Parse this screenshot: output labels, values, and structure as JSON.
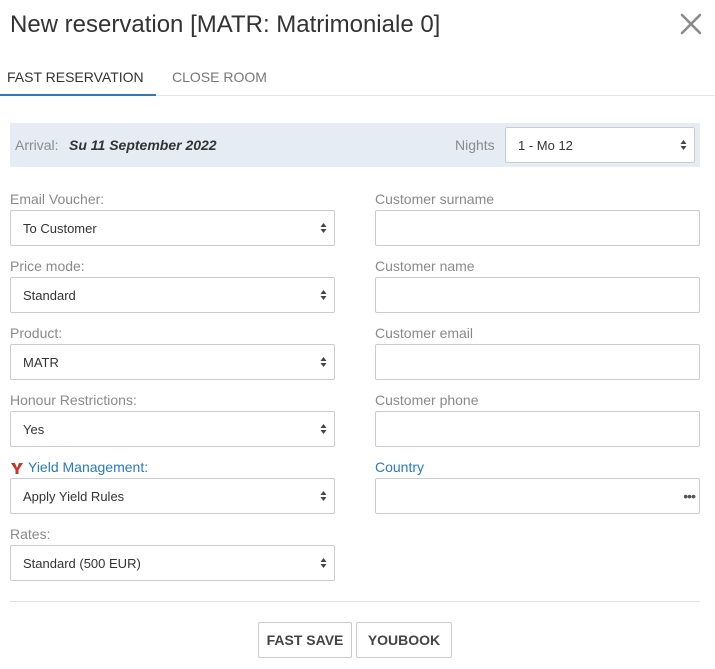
{
  "header": {
    "title": "New reservation [MATR: Matrimoniale 0]"
  },
  "tabs": [
    {
      "label": "FAST RESERVATION",
      "active": true
    },
    {
      "label": "CLOSE ROOM",
      "active": false
    }
  ],
  "arrival": {
    "label": "Arrival:",
    "date": "Su 11 September 2022",
    "nights_label": "Nights",
    "nights_value": "1 - Mo 12"
  },
  "left_fields": {
    "email_voucher": {
      "label": "Email Voucher:",
      "value": "To Customer"
    },
    "price_mode": {
      "label": "Price mode:",
      "value": "Standard"
    },
    "product": {
      "label": "Product:",
      "value": "MATR"
    },
    "honour_restrictions": {
      "label": "Honour Restrictions:",
      "value": "Yes"
    },
    "yield_management": {
      "label": "Yield Management:",
      "value": "Apply Yield Rules"
    },
    "rates": {
      "label": "Rates:",
      "value": "Standard (500 EUR)"
    }
  },
  "right_fields": {
    "surname": {
      "label": "Customer surname",
      "value": ""
    },
    "name": {
      "label": "Customer name",
      "value": ""
    },
    "email": {
      "label": "Customer email",
      "value": ""
    },
    "phone": {
      "label": "Customer phone",
      "value": ""
    },
    "country": {
      "label": "Country",
      "value": "",
      "more": "•••"
    }
  },
  "footer": {
    "fast_save": "FAST SAVE",
    "youbook": "YOUBOOK"
  },
  "colors": {
    "accent": "#2a7bbd",
    "arrival_bg": "#e6ecf4",
    "yield_icon": "#c0392b"
  },
  "icons": {
    "close": "close-icon",
    "select": "select-arrows-icon",
    "yield": "yield-management-icon"
  }
}
